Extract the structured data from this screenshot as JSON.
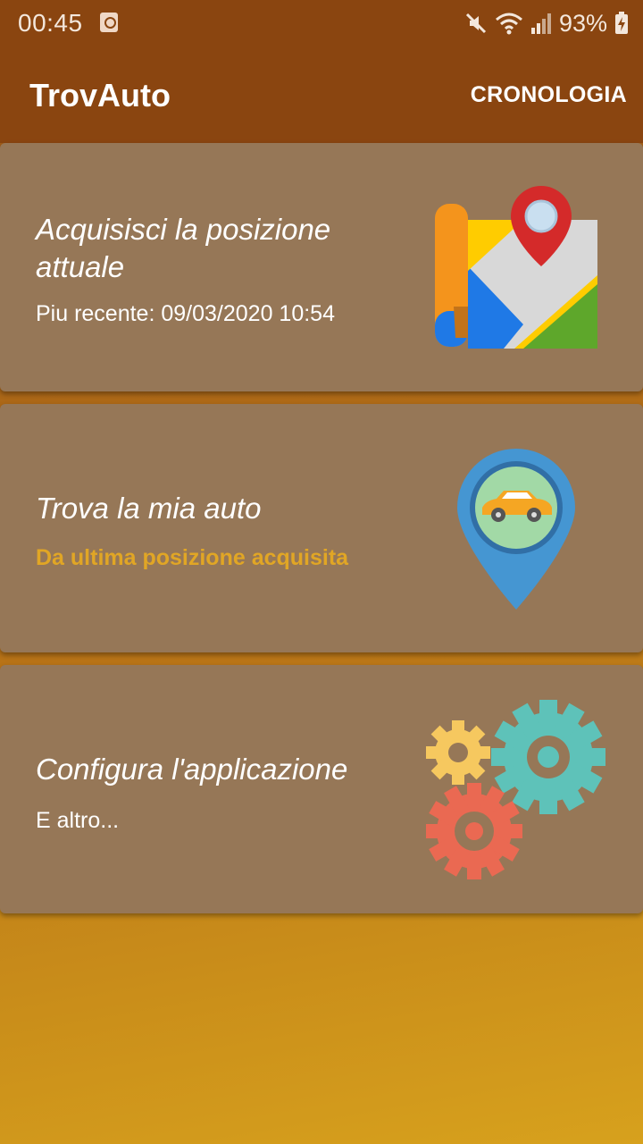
{
  "status_bar": {
    "time": "00:45",
    "battery": "93%",
    "icons": [
      "clock-notification-icon",
      "mute-icon",
      "wifi-icon",
      "signal-icon",
      "battery-charging-icon"
    ]
  },
  "app_bar": {
    "title": "TrovAuto",
    "action": "CRONOLOGIA"
  },
  "cards": [
    {
      "title": "Acquisisci la posizione attuale",
      "subtitle": "Piu recente: 09/03/2020 10:54",
      "icon": "map-pin-icon"
    },
    {
      "title": "Trova la mia auto",
      "subtitle": "Da ultima posizione acquisita",
      "icon": "car-location-icon"
    },
    {
      "title": "Configura l'applicazione",
      "subtitle": "E altro...",
      "icon": "gears-icon"
    }
  ],
  "colors": {
    "app_bar": "#8a4510",
    "card": "#967757",
    "accent_text": "#e1a625"
  }
}
